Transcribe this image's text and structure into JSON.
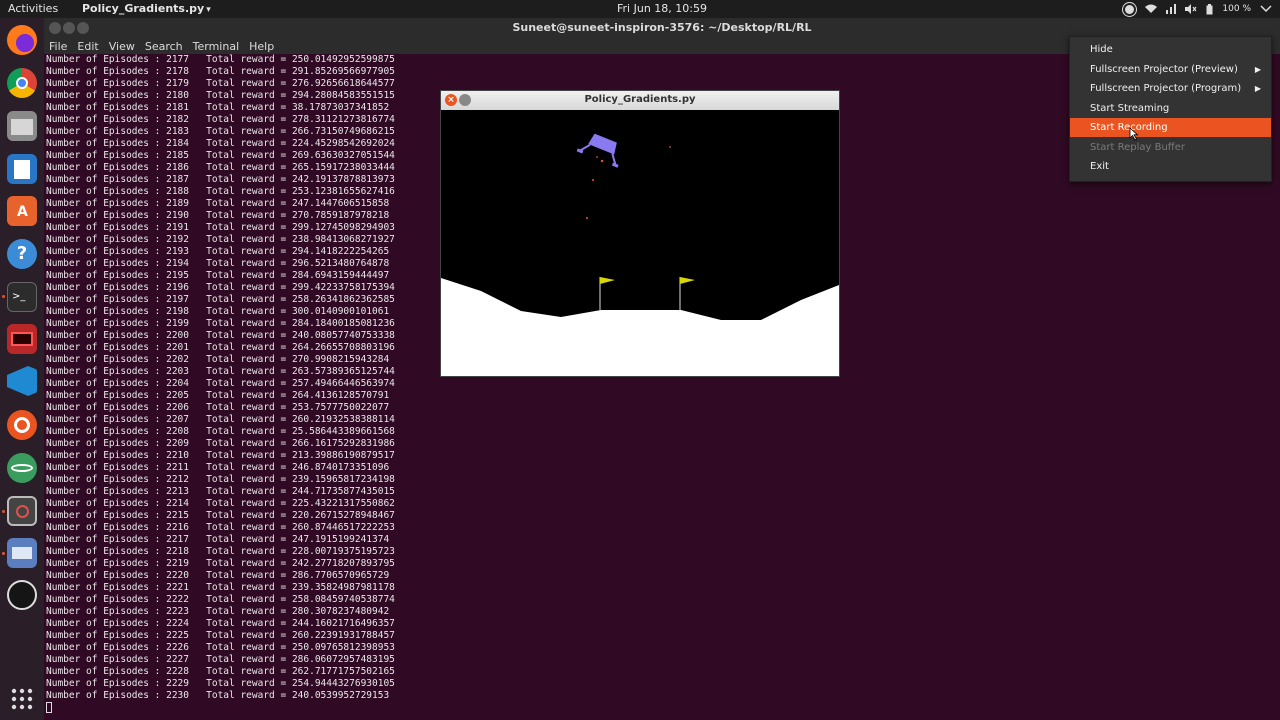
{
  "topbar": {
    "activities": "Activities",
    "app_name": "Policy_Gradients.py",
    "app_arrow": "▾",
    "clock": "Fri Jun 18, 10:59",
    "battery": "100 %"
  },
  "terminal": {
    "title": "Suneet@suneet-inspiron-3576: ~/Desktop/RL/RL",
    "menu": [
      "File",
      "Edit",
      "View",
      "Search",
      "Terminal",
      "Help"
    ],
    "lines": [
      "Number of Episodes : 2177   Total reward = 250.01492952599875",
      "Number of Episodes : 2178   Total reward = 291.85269566977905",
      "Number of Episodes : 2179   Total reward = 276.92656618644577",
      "Number of Episodes : 2180   Total reward = 294.28084583551515",
      "Number of Episodes : 2181   Total reward = 38.17873037341852",
      "Number of Episodes : 2182   Total reward = 278.31121273816774",
      "Number of Episodes : 2183   Total reward = 266.73150749686215",
      "Number of Episodes : 2184   Total reward = 224.45298542692024",
      "Number of Episodes : 2185   Total reward = 269.63630327051544",
      "Number of Episodes : 2186   Total reward = 265.15917238033444",
      "Number of Episodes : 2187   Total reward = 242.19137878813973",
      "Number of Episodes : 2188   Total reward = 253.12381655627416",
      "Number of Episodes : 2189   Total reward = 247.1447606515858",
      "Number of Episodes : 2190   Total reward = 270.7859187978218",
      "Number of Episodes : 2191   Total reward = 299.12745098294903",
      "Number of Episodes : 2192   Total reward = 238.98413068271927",
      "Number of Episodes : 2193   Total reward = 294.1418222254265",
      "Number of Episodes : 2194   Total reward = 296.5213480764878",
      "Number of Episodes : 2195   Total reward = 284.6943159444497",
      "Number of Episodes : 2196   Total reward = 299.42233758175394",
      "Number of Episodes : 2197   Total reward = 258.26341862362585",
      "Number of Episodes : 2198   Total reward = 300.0140900101061",
      "Number of Episodes : 2199   Total reward = 284.18400185081236",
      "Number of Episodes : 2200   Total reward = 240.08057740753338",
      "Number of Episodes : 2201   Total reward = 264.26655708803196",
      "Number of Episodes : 2202   Total reward = 270.9908215943284",
      "Number of Episodes : 2203   Total reward = 263.57389365125744",
      "Number of Episodes : 2204   Total reward = 257.49466446563974",
      "Number of Episodes : 2205   Total reward = 264.4136128570791",
      "Number of Episodes : 2206   Total reward = 253.7577750022077",
      "Number of Episodes : 2207   Total reward = 260.21932538388114",
      "Number of Episodes : 2208   Total reward = 25.586443389661568",
      "Number of Episodes : 2209   Total reward = 266.16175292831986",
      "Number of Episodes : 2210   Total reward = 213.39886190879517",
      "Number of Episodes : 2211   Total reward = 246.8740173351096",
      "Number of Episodes : 2212   Total reward = 239.15965817234198",
      "Number of Episodes : 2213   Total reward = 244.71735877435015",
      "Number of Episodes : 2214   Total reward = 225.43221317550862",
      "Number of Episodes : 2215   Total reward = 220.26715278948467",
      "Number of Episodes : 2216   Total reward = 260.87446517222253",
      "Number of Episodes : 2217   Total reward = 247.1915199241374",
      "Number of Episodes : 2218   Total reward = 228.00719375195723",
      "Number of Episodes : 2219   Total reward = 242.27718207893795",
      "Number of Episodes : 2220   Total reward = 286.7706570965729",
      "Number of Episodes : 2221   Total reward = 239.35824987981178",
      "Number of Episodes : 2222   Total reward = 258.08459740538774",
      "Number of Episodes : 2223   Total reward = 280.3078237480942",
      "Number of Episodes : 2224   Total reward = 244.16021716496357",
      "Number of Episodes : 2225   Total reward = 260.22391931788457",
      "Number of Episodes : 2226   Total reward = 250.09765812398953",
      "Number of Episodes : 2227   Total reward = 286.06072957483195",
      "Number of Episodes : 2228   Total reward = 262.71771757502165",
      "Number of Episodes : 2229   Total reward = 254.94443276930105",
      "Number of Episodes : 2230   Total reward = 240.0539952729153"
    ]
  },
  "game_window": {
    "title": "Policy_Gradients.py",
    "close_glyph": "×"
  },
  "context_menu": {
    "items": [
      {
        "label": "Hide",
        "state": "normal",
        "submenu": false
      },
      {
        "label": "Fullscreen Projector (Preview)",
        "state": "normal",
        "submenu": true
      },
      {
        "label": "Fullscreen Projector (Program)",
        "state": "normal",
        "submenu": true
      },
      {
        "label": "Start Streaming",
        "state": "normal",
        "submenu": false
      },
      {
        "label": "Start Recording",
        "state": "active",
        "submenu": false
      },
      {
        "label": "Start Replay Buffer",
        "state": "disabled",
        "submenu": false
      },
      {
        "label": "Exit",
        "state": "normal",
        "submenu": false
      }
    ]
  },
  "dock": {
    "icons": [
      "firefox-icon",
      "chrome-icon",
      "files-icon",
      "libreoffice-writer-icon",
      "software-center-icon",
      "help-icon",
      "terminal-icon",
      "screen-recorder-icon",
      "vscode-icon",
      "ubuntu-icon",
      "atom-icon",
      "obs-app-icon",
      "system-monitor-icon",
      "obs-studio-icon",
      "app-grid-icon"
    ]
  },
  "colors": {
    "accent": "#e95420",
    "terminal_bg": "#300a24",
    "menu_bg": "#333333",
    "lander": "#8a7af0",
    "flag": "#d8d800"
  }
}
